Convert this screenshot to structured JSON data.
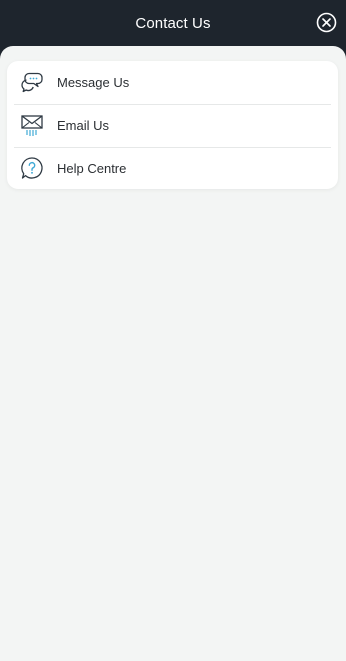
{
  "header": {
    "title": "Contact Us",
    "close_icon": "close-circle-icon"
  },
  "menu": {
    "items": [
      {
        "label": "Message Us",
        "icon": "chat-bubbles-icon"
      },
      {
        "label": "Email Us",
        "icon": "envelope-icon"
      },
      {
        "label": "Help Centre",
        "icon": "question-bubble-icon"
      }
    ]
  },
  "colors": {
    "header_bg": "#1e252d",
    "sheet_bg": "#f3f5f4",
    "card_bg": "#ffffff",
    "icon_dark": "#2f3a44",
    "icon_accent": "#3fa9d6"
  }
}
